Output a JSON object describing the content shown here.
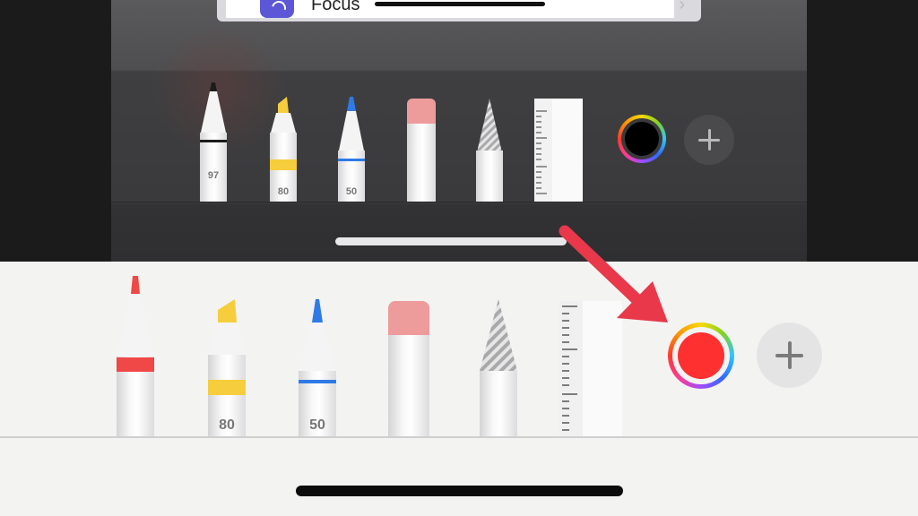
{
  "top_panel": {
    "focus_label": "Focus",
    "tools": [
      {
        "name": "pen",
        "label": "97",
        "tip_color": "#1c1c1c",
        "band_color": "#1c1c1c"
      },
      {
        "name": "highlighter",
        "label": "80",
        "tip_color": "#f6cd3c",
        "band_color": "#f6cd3c"
      },
      {
        "name": "pencil",
        "label": "50",
        "tip_color": "#2f7ae5",
        "band_color": "#2f7ae5"
      },
      {
        "name": "eraser",
        "label": "",
        "tip_color": "#ee9b9b"
      },
      {
        "name": "lasso",
        "label": ""
      },
      {
        "name": "ruler",
        "label": ""
      }
    ],
    "selected_color": "#000000",
    "add_icon": "plus-icon"
  },
  "bottom_panel": {
    "tools": [
      {
        "name": "pen",
        "label": "",
        "tip_color": "#f04747",
        "band_color": "#f04747"
      },
      {
        "name": "highlighter",
        "label": "80",
        "tip_color": "#f6cd3c",
        "band_color": "#f6cd3c"
      },
      {
        "name": "pencil",
        "label": "50",
        "tip_color": "#2f7ae5",
        "band_color": "#2f7ae5"
      },
      {
        "name": "eraser",
        "label": "",
        "tip_color": "#ee9b9b"
      },
      {
        "name": "lasso",
        "label": ""
      },
      {
        "name": "ruler",
        "label": ""
      }
    ],
    "selected_color": "#ff3030",
    "add_icon": "plus-icon"
  },
  "annotation": {
    "arrow_color": "#e8384a",
    "points_to": "color-picker"
  }
}
